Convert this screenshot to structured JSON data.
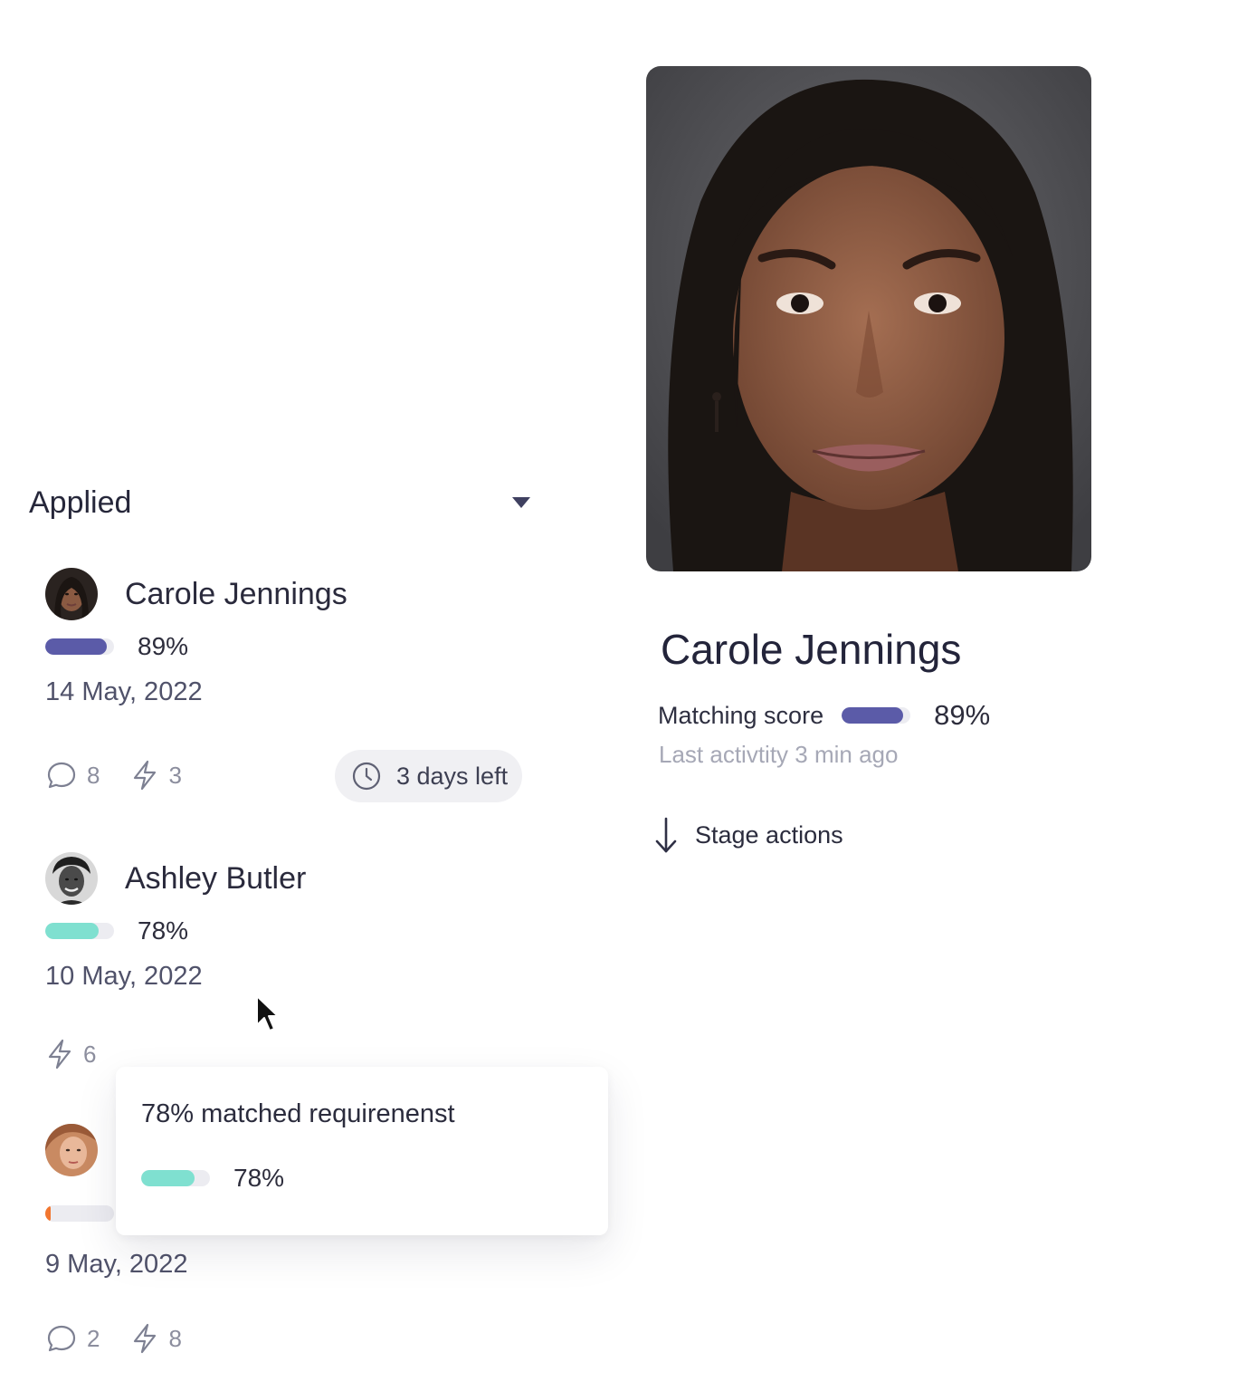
{
  "stage": {
    "title": "Applied",
    "dropdown_icon": "caret-down-icon"
  },
  "candidates": [
    {
      "name": "Carole Jennings",
      "score": "89%",
      "score_fraction": 0.89,
      "bar_color": "#5b5ba8",
      "date": "14 May, 2022",
      "comments": "8",
      "actions": "3",
      "deadline": "3 days left"
    },
    {
      "name": "Ashley Butler",
      "score": "78%",
      "score_fraction": 0.78,
      "bar_color": "#7fe0d0",
      "date": "10 May, 2022",
      "actions": "6"
    },
    {
      "score_fraction": 0.08,
      "bar_color": "#f2762f",
      "date": "9 May, 2022",
      "comments": "2",
      "actions": "8"
    }
  ],
  "tooltip": {
    "title": "78% matched requirenenst",
    "score": "78%",
    "score_fraction": 0.78,
    "bar_color": "#7fe0d0"
  },
  "detail": {
    "name": "Carole Jennings",
    "matching_label": "Matching score",
    "score": "89%",
    "score_fraction": 0.89,
    "bar_color": "#5b5ba8",
    "last_activity": "Last activtity 3 min ago",
    "stage_actions": "Stage actions"
  }
}
